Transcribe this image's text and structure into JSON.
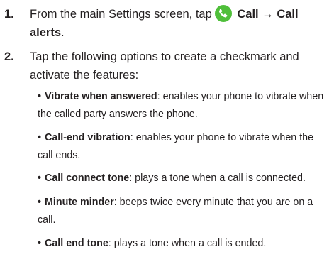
{
  "steps": [
    {
      "number": "1.",
      "prefix": "From the main Settings screen, tap",
      "icon": "phone-call-icon",
      "path_1": "Call",
      "arrow": "→",
      "path_2": "Call alerts",
      "suffix": "."
    },
    {
      "number": "2.",
      "text": "Tap the following options to create a checkmark and activate the features:"
    }
  ],
  "bullets": [
    {
      "term": "Vibrate when answered",
      "desc": ": enables your phone to vibrate when the called party answers the phone."
    },
    {
      "term": "Call-end vibration",
      "desc": ": enables your phone to vibrate when the call ends."
    },
    {
      "term": "Call connect tone",
      "desc": ": plays a tone when a call is connected."
    },
    {
      "term": "Minute minder",
      "desc": ": beeps twice every minute that you are on a call."
    },
    {
      "term": "Call end tone",
      "desc": ": plays a tone when a call is ended."
    }
  ],
  "colors": {
    "text": "#231f20",
    "call_icon": "#4fbf3a"
  }
}
